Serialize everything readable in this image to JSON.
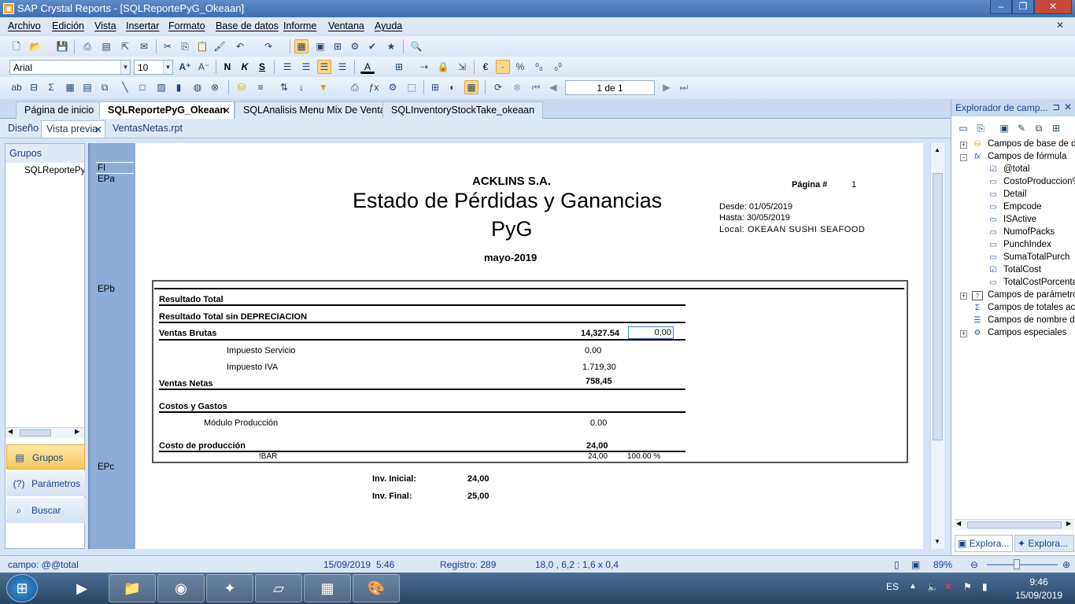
{
  "window": {
    "title": "SAP Crystal Reports - [SQLReportePyG_Okeaan]"
  },
  "menu": [
    "Archivo",
    "Edición",
    "Vista",
    "Insertar",
    "Formato",
    "Base de datos",
    "Informe",
    "Ventana",
    "Ayuda"
  ],
  "format_toolbar": {
    "font": "Arial",
    "size": "10"
  },
  "nav": {
    "page": "1 de 1"
  },
  "doc_tabs": [
    "Página de inicio",
    "SQLReportePyG_Okeaan",
    "SQLAnalisis Menu Mix De Venta",
    "SQLInventoryStockTake_okeaan"
  ],
  "view_tabs": [
    "Diseño",
    "Vista previa",
    "VentasNetas.rpt"
  ],
  "left": {
    "header": "Grupos",
    "tree_item": "SQLReportePyG",
    "buttons": [
      "Grupos",
      "Parámetros",
      "Buscar"
    ]
  },
  "bands": [
    "FI",
    "EPa",
    "EPb",
    "EPc"
  ],
  "report": {
    "company": "ACKLINS S.A.",
    "title": "Estado de Pérdidas y Ganancias",
    "subtitle": "PyG",
    "period": "mayo-2019",
    "page_label": "Página #",
    "page_no": "1",
    "desde": "Desde: 01/05/2019",
    "hasta": "Hasta: 30/05/2019",
    "local": "Local: OKEAAN SUSHI SEAFOOD",
    "rows": {
      "res_total": "Resultado Total",
      "res_sin_dep": "Resultado Total sin DEPRECIACION",
      "ventas_brutas": "Ventas Brutas",
      "ventas_brutas_val": "14,327.54",
      "ventas_brutas_pct": "0,00",
      "imp_serv": "Impuesto Servicio",
      "imp_serv_val": "0.00",
      "imp_iva": "Impuesto IVA",
      "imp_iva_val": "1.719,30",
      "ventas_netas": "Ventas Netas",
      "ventas_netas_val": "758,45",
      "costos": "Costos y Gastos",
      "modulo": "Módulo Producción",
      "modulo_val": "0.00",
      "costo_prod": "Costo de producción",
      "costo_prod_val": "24,00",
      "bar": "!BAR",
      "bar_val": "24,00",
      "bar_pct": "100.00 %"
    },
    "inv_inicial_label": "Inv. Inicial:",
    "inv_inicial": "24,00",
    "inv_final_label": "Inv. Final:",
    "inv_final": "25,00"
  },
  "explorer": {
    "title": "Explorador de camp...",
    "items": [
      "Campos de base de da",
      "Campos de fórmula",
      "@total",
      "CostoProduccion%",
      "Detail",
      "Empcode",
      "ISActive",
      "NumofPacks",
      "PunchIndex",
      "SumaTotalPurch",
      "TotalCost",
      "TotalCostPorcenta",
      "Campos de parámetro",
      "Campos de totales acu",
      "Campos de nombre de",
      "Campos especiales"
    ],
    "bottom_tabs": [
      "Explora...",
      "Explora..."
    ]
  },
  "status": {
    "field": "campo: @@total",
    "date": "15/09/2019",
    "time": "5:46",
    "records": "Registro:  289",
    "coords": "18,0 , 6,2 : 1,6 x 0,4",
    "zoom": "89%"
  },
  "taskbar": {
    "lang": "ES",
    "time": "9:46",
    "date": "15/09/2019"
  }
}
